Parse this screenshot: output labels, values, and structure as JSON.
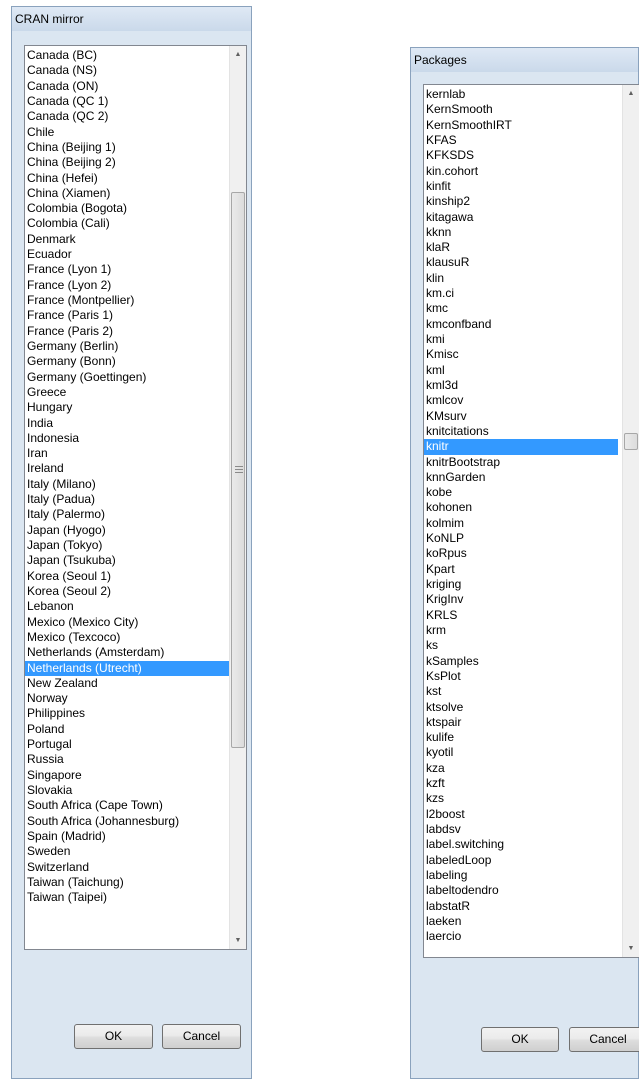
{
  "mirror_dialog": {
    "title": "CRAN mirror",
    "items": [
      "Canada (BC)",
      "Canada (NS)",
      "Canada (ON)",
      "Canada (QC 1)",
      "Canada (QC 2)",
      "Chile",
      "China (Beijing 1)",
      "China (Beijing 2)",
      "China (Hefei)",
      "China (Xiamen)",
      "Colombia (Bogota)",
      "Colombia (Cali)",
      "Denmark",
      "Ecuador",
      "France (Lyon 1)",
      "France (Lyon 2)",
      "France (Montpellier)",
      "France (Paris 1)",
      "France (Paris 2)",
      "Germany (Berlin)",
      "Germany (Bonn)",
      "Germany (Goettingen)",
      "Greece",
      "Hungary",
      "India",
      "Indonesia",
      "Iran",
      "Ireland",
      "Italy (Milano)",
      "Italy (Padua)",
      "Italy (Palermo)",
      "Japan (Hyogo)",
      "Japan (Tokyo)",
      "Japan (Tsukuba)",
      "Korea (Seoul 1)",
      "Korea (Seoul 2)",
      "Lebanon",
      "Mexico (Mexico City)",
      "Mexico (Texcoco)",
      "Netherlands (Amsterdam)",
      "Netherlands (Utrecht)",
      "New Zealand",
      "Norway",
      "Philippines",
      "Poland",
      "Portugal",
      "Russia",
      "Singapore",
      "Slovakia",
      "South Africa (Cape Town)",
      "South Africa (Johannesburg)",
      "Spain (Madrid)",
      "Sweden",
      "Switzerland",
      "Taiwan (Taichung)",
      "Taiwan (Taipei)"
    ],
    "selected": "Netherlands (Utrecht)",
    "ok_label": "OK",
    "cancel_label": "Cancel"
  },
  "packages_dialog": {
    "title": "Packages",
    "items": [
      "kernlab",
      "KernSmooth",
      "KernSmoothIRT",
      "KFAS",
      "KFKSDS",
      "kin.cohort",
      "kinfit",
      "kinship2",
      "kitagawa",
      "kknn",
      "klaR",
      "klausuR",
      "klin",
      "km.ci",
      "kmc",
      "kmconfband",
      "kmi",
      "Kmisc",
      "kml",
      "kml3d",
      "kmlcov",
      "KMsurv",
      "knitcitations",
      "knitr",
      "knitrBootstrap",
      "knnGarden",
      "kobe",
      "kohonen",
      "kolmim",
      "KoNLP",
      "koRpus",
      "Kpart",
      "kriging",
      "KrigInv",
      "KRLS",
      "krm",
      "ks",
      "kSamples",
      "KsPlot",
      "kst",
      "ktsolve",
      "ktspair",
      "kulife",
      "kyotil",
      "kza",
      "kzft",
      "kzs",
      "l2boost",
      "labdsv",
      "label.switching",
      "labeledLoop",
      "labeling",
      "labeltodendro",
      "labstatR",
      "laeken",
      "laercio"
    ],
    "selected": "knitr",
    "ok_label": "OK",
    "cancel_label": "Cancel"
  }
}
